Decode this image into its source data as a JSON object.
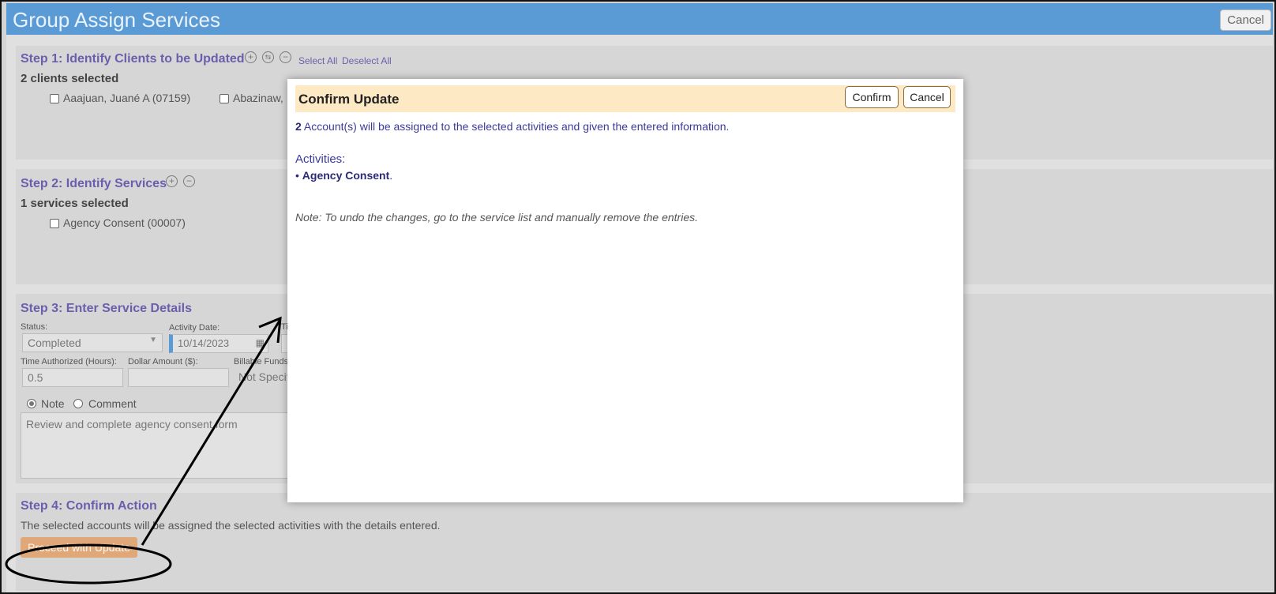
{
  "window": {
    "title": "Group Assign Services",
    "cancel_label": "Cancel"
  },
  "step1": {
    "title": "Step 1: Identify Clients to be Updated",
    "select_all": "Select All",
    "deselect_all": "Deselect All",
    "count_text": "2 clients selected",
    "clients": [
      {
        "label": "Aaajuan, Juané A  (07159)",
        "checked": false
      },
      {
        "label": "Abazinaw,",
        "checked": false
      }
    ]
  },
  "step2": {
    "title": "Step 2: Identify Services",
    "count_text": "1 services selected",
    "services": [
      {
        "label": "Agency Consent  (00007)",
        "checked": false
      }
    ]
  },
  "step3": {
    "title": "Step 3: Enter Service Details",
    "status_label": "Status:",
    "status_value": "Completed",
    "activity_date_label": "Activity Date:",
    "activity_date_value": "10/14/2023",
    "time_label_partial": "Ti",
    "time_authorized_label": "Time Authorized (Hours):",
    "time_authorized_value": "0.5",
    "dollar_amount_label": "Dollar Amount ($):",
    "dollar_amount_value": "",
    "billable_label": "Billable Funds",
    "billable_value": "Not Specif",
    "note_radio": "Note",
    "comment_radio": "Comment",
    "note_selected": "Note",
    "note_text": "Review and complete agency consent form"
  },
  "step4": {
    "title": "Step 4: Confirm Action",
    "description": "The selected accounts will be assigned the selected activities with the details entered.",
    "proceed_label": "Proceed with Update"
  },
  "modal": {
    "title": "Confirm Update",
    "confirm_label": "Confirm",
    "cancel_label": "Cancel",
    "count": "2",
    "message": "Account(s) will be assigned to the selected activities and given the entered information.",
    "activities_label": "Activities:",
    "activities": [
      "Agency Consent"
    ],
    "note": "Note: To undo the changes, go to the service list and manually remove the entries."
  },
  "colors": {
    "titlebar": "#5b9bd5",
    "step_title": "#6b5fad",
    "modal_header": "#fde9c4",
    "proceed_button": "#e0a878"
  }
}
